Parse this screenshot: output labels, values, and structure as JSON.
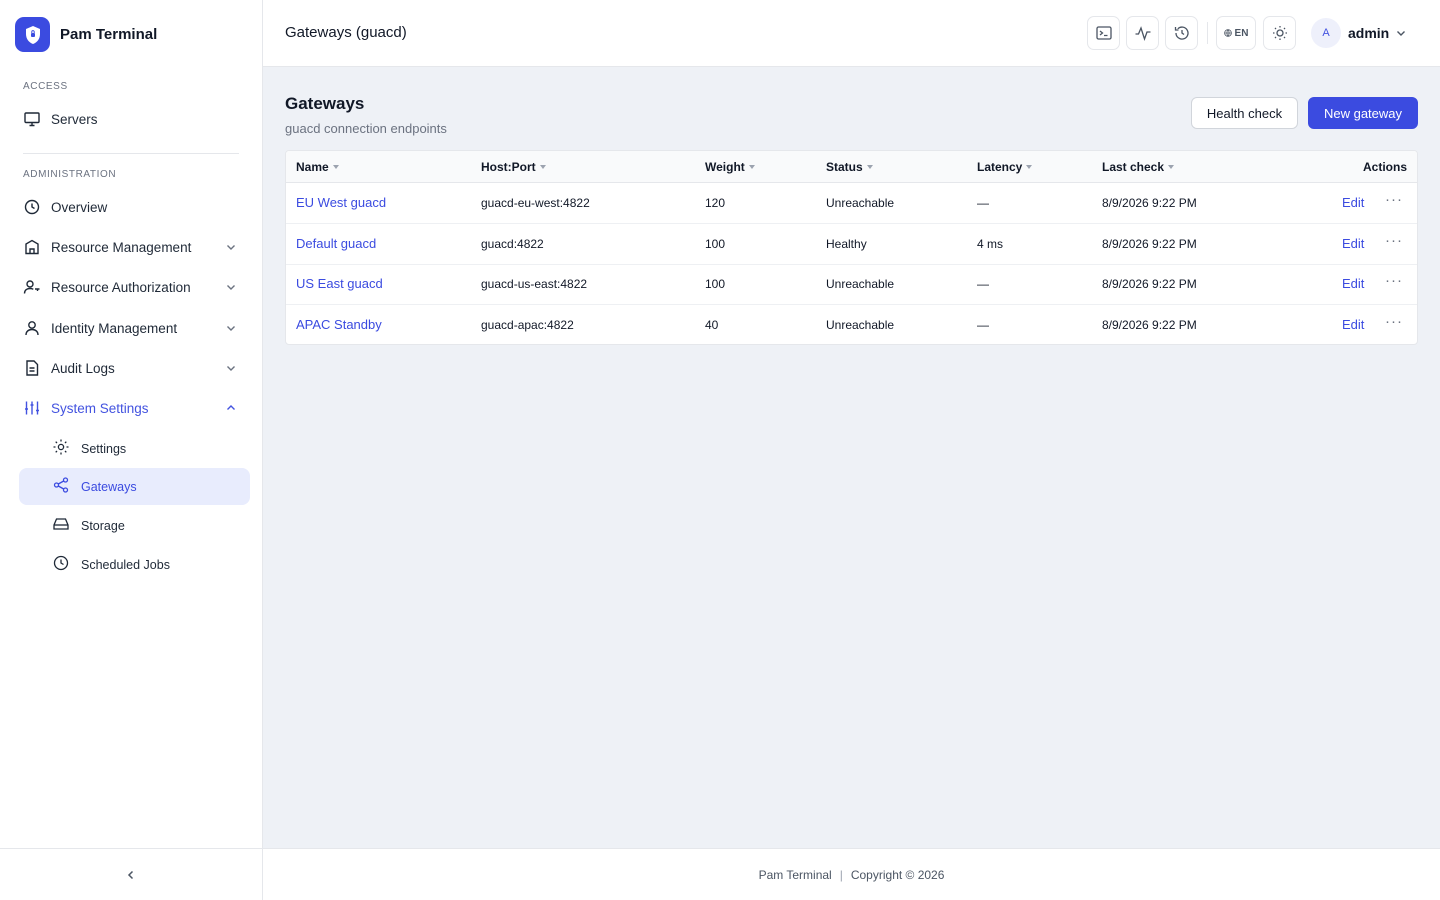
{
  "app": {
    "name": "Pam Terminal"
  },
  "sidebar": {
    "access_label": "ACCESS",
    "admin_label": "ADMINISTRATION",
    "servers": "Servers",
    "overview": "Overview",
    "resource_management": "Resource Management",
    "resource_authorization": "Resource Authorization",
    "identity_management": "Identity Management",
    "audit_logs": "Audit Logs",
    "system_settings": "System Settings",
    "sub": {
      "settings": "Settings",
      "gateways": "Gateways",
      "storage": "Storage",
      "scheduled_jobs": "Scheduled Jobs"
    }
  },
  "header": {
    "title": "Gateways (guacd)",
    "lang": "EN",
    "avatar_initial": "A",
    "user": "admin"
  },
  "page": {
    "title": "Gateways",
    "subtitle": "guacd connection endpoints",
    "health_check": "Health check",
    "new_gateway": "New gateway"
  },
  "table": {
    "columns": {
      "name": "Name",
      "host": "Host:Port",
      "weight": "Weight",
      "status": "Status",
      "latency": "Latency",
      "last_check": "Last check",
      "actions": "Actions"
    },
    "edit_label": "Edit",
    "more_label": "···",
    "rows": [
      {
        "name": "EU West guacd",
        "host": "guacd-eu-west:4822",
        "weight": "120",
        "status": "Unreachable",
        "latency": "—",
        "last_check": "8/9/2026 9:22 PM"
      },
      {
        "name": "Default guacd",
        "host": "guacd:4822",
        "weight": "100",
        "status": "Healthy",
        "latency": "4 ms",
        "last_check": "8/9/2026 9:22 PM"
      },
      {
        "name": "US East guacd",
        "host": "guacd-us-east:4822",
        "weight": "100",
        "status": "Unreachable",
        "latency": "—",
        "last_check": "8/9/2026 9:22 PM"
      },
      {
        "name": "APAC Standby",
        "host": "guacd-apac:4822",
        "weight": "40",
        "status": "Unreachable",
        "latency": "—",
        "last_check": "8/9/2026 9:22 PM"
      }
    ]
  },
  "footer": {
    "brand": "Pam Terminal",
    "separator": "|",
    "copyright": "Copyright © 2026"
  },
  "colors": {
    "accent": "#3b4be0",
    "selected_bg": "#e8ecfd",
    "page_bg": "#eef1f6"
  }
}
